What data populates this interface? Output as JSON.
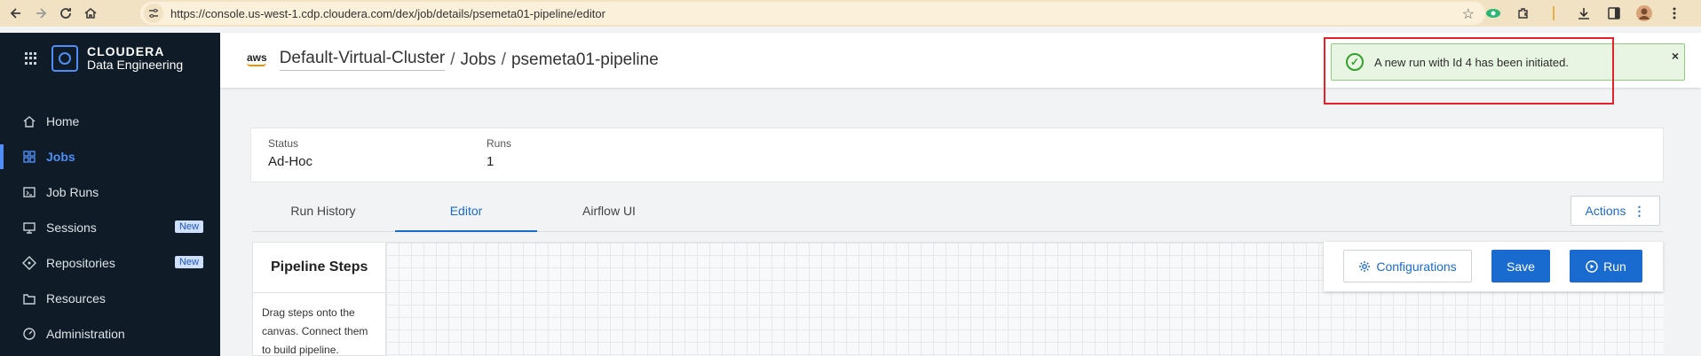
{
  "browser": {
    "url": "https://console.us-west-1.cdp.cloudera.com/dex/job/details/psemeta01-pipeline/editor"
  },
  "brand": {
    "name": "CLOUDERA",
    "product": "Data Engineering"
  },
  "sidebar": {
    "items": [
      {
        "label": "Home",
        "icon": "home-icon"
      },
      {
        "label": "Jobs",
        "icon": "jobs-icon",
        "active": true
      },
      {
        "label": "Job Runs",
        "icon": "job-runs-icon"
      },
      {
        "label": "Sessions",
        "icon": "sessions-icon",
        "badge": "New"
      },
      {
        "label": "Repositories",
        "icon": "repositories-icon",
        "badge": "New"
      },
      {
        "label": "Resources",
        "icon": "resources-icon"
      },
      {
        "label": "Administration",
        "icon": "administration-icon"
      }
    ]
  },
  "header": {
    "provider": "aws",
    "cluster": "Default-Virtual-Cluster",
    "separator": "/",
    "section": "Jobs",
    "job": "psemeta01-pipeline"
  },
  "toast": {
    "message": "A new run with Id 4 has been initiated.",
    "close": "×"
  },
  "summary": {
    "status_label": "Status",
    "status_value": "Ad-Hoc",
    "runs_label": "Runs",
    "runs_value": "1"
  },
  "tabs": [
    {
      "label": "Run History"
    },
    {
      "label": "Editor",
      "active": true
    },
    {
      "label": "Airflow UI"
    }
  ],
  "actions": {
    "label": "Actions",
    "dots": "⋮"
  },
  "pipeline": {
    "title": "Pipeline Steps",
    "description": "Drag steps onto the canvas. Connect them to build pipeline."
  },
  "toolbar": {
    "configurations": "Configurations",
    "save": "Save",
    "run": "Run"
  },
  "colors": {
    "accent": "#1a6bd0",
    "sidebar_bg": "#0f1b26",
    "toast_bg": "#e8f5e2",
    "highlight": "#e8202a"
  }
}
